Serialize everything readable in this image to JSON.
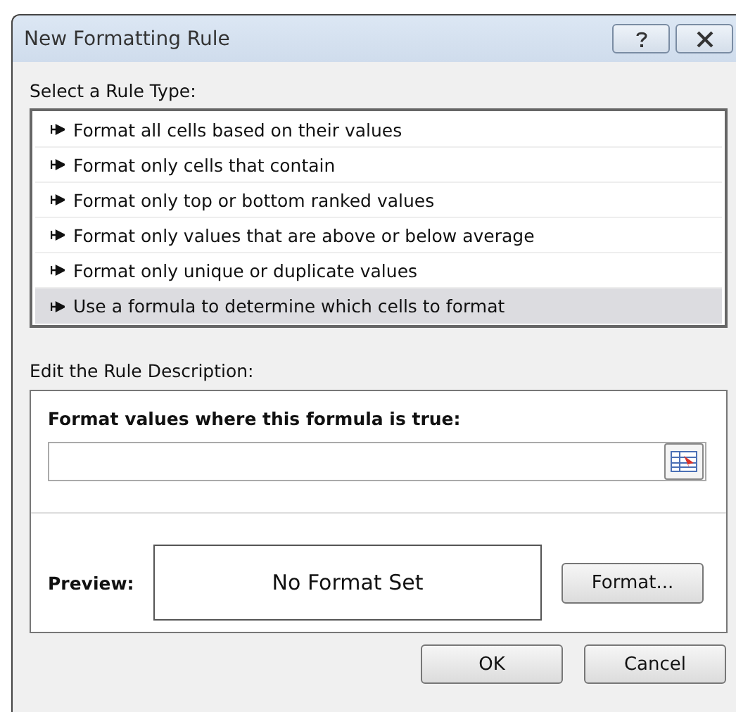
{
  "window": {
    "title": "New Formatting Rule"
  },
  "rule_type": {
    "label": "Select a Rule Type:",
    "items": [
      {
        "label": "Format all cells based on their values",
        "selected": false
      },
      {
        "label": "Format only cells that contain",
        "selected": false
      },
      {
        "label": "Format only top or bottom ranked values",
        "selected": false
      },
      {
        "label": "Format only values that are above or below average",
        "selected": false
      },
      {
        "label": "Format only unique or duplicate values",
        "selected": false
      },
      {
        "label": "Use a formula to determine which cells to format",
        "selected": true
      }
    ]
  },
  "rule_description": {
    "label": "Edit the Rule Description:",
    "formula_label": "Format values where this formula is true:",
    "preview_label": "Preview:",
    "preview_text": "No Format Set",
    "format_button": "Format..."
  },
  "buttons": [
    "OK",
    "Cancel"
  ]
}
